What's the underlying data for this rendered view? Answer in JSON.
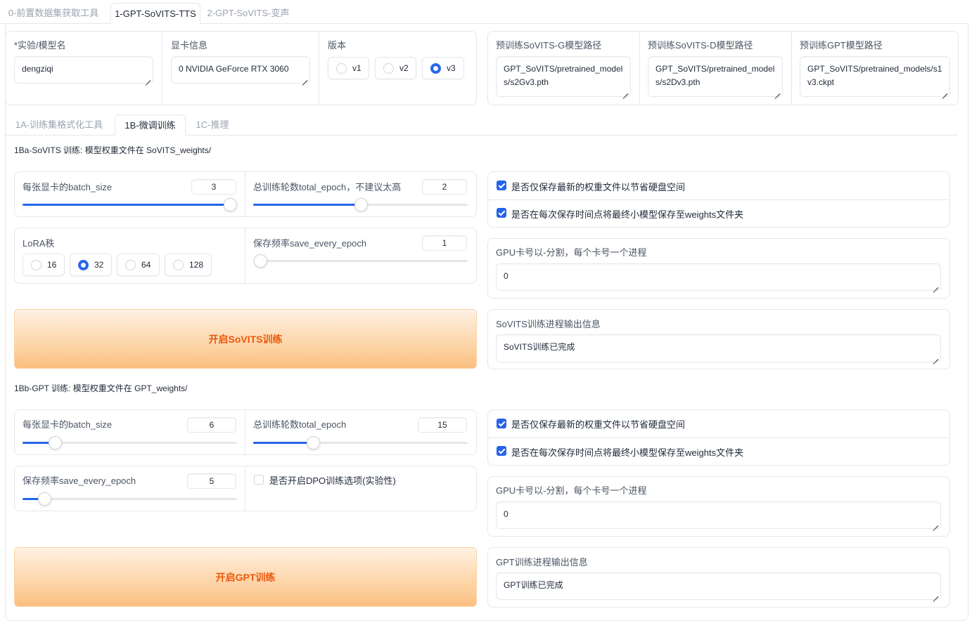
{
  "top_tabs": [
    "0-前置数据集获取工具",
    "1-GPT-SoVITS-TTS",
    "2-GPT-SoVITS-变声"
  ],
  "top_tab_active": 1,
  "config": {
    "exp_name_label": "*实验/模型名",
    "exp_name_value": "dengziqi",
    "gpu_info_label": "显卡信息",
    "gpu_info_value": "0 NVIDIA GeForce RTX 3060",
    "version_label": "版本",
    "version_options": [
      "v1",
      "v2",
      "v3"
    ],
    "version_selected": "v3"
  },
  "pretrained": {
    "sovits_g_label": "预训练SoVITS-G模型路径",
    "sovits_g_value": "GPT_SoVITS/pretrained_models/s2Gv3.pth",
    "sovits_d_label": "预训练SoVITS-D模型路径",
    "sovits_d_value": "GPT_SoVITS/pretrained_models/s2Dv3.pth",
    "gpt_label": "预训练GPT模型路径",
    "gpt_value": "GPT_SoVITS/pretrained_models/s1v3.ckpt"
  },
  "sub_tabs": [
    "1A-训练集格式化工具",
    "1B-微调训练",
    "1C-推理"
  ],
  "sub_tab_active": 1,
  "sovits": {
    "section_title": "1Ba-SoVITS 训练: 模型权重文件在 SoVITS_weights/",
    "batch_size_label": "每张显卡的batch_size",
    "batch_size_value": "3",
    "batch_size_fraction": 1.0,
    "total_epoch_label": "总训练轮数total_epoch，不建议太高",
    "total_epoch_value": "2",
    "total_epoch_fraction": 0.5,
    "lora_label": "LoRA秩",
    "lora_options": [
      "16",
      "32",
      "64",
      "128"
    ],
    "lora_selected": "32",
    "save_every_label": "保存频率save_every_epoch",
    "save_every_value": "1",
    "save_every_fraction": 0.0,
    "if_save_latest_label": "是否仅保存最新的权重文件以节省硬盘空间",
    "if_save_latest": true,
    "if_save_every_weights_label": "是否在每次保存时间点将最终小模型保存至weights文件夹",
    "if_save_every_weights": true,
    "gpu_numbers_label": "GPU卡号以-分割，每个卡号一个进程",
    "gpu_numbers_value": "0",
    "start_button": "开启SoVITS训练",
    "output_label": "SoVITS训练进程输出信息",
    "output_value": "SoVITS训练已完成"
  },
  "gpt": {
    "section_title": "1Bb-GPT 训练: 模型权重文件在 GPT_weights/",
    "batch_size_label": "每张显卡的batch_size",
    "batch_size_value": "6",
    "batch_size_fraction": 0.15,
    "total_epoch_label": "总训练轮数total_epoch",
    "total_epoch_value": "15",
    "total_epoch_fraction": 0.28,
    "save_every_label": "保存频率save_every_epoch",
    "save_every_value": "5",
    "save_every_fraction": 0.1,
    "dpo_label": "是否开启DPO训练选项(实验性)",
    "dpo_enabled": false,
    "if_save_latest_label": "是否仅保存最新的权重文件以节省硬盘空间",
    "if_save_latest": true,
    "if_save_every_weights_label": "是否在每次保存时间点将最终小模型保存至weights文件夹",
    "if_save_every_weights": true,
    "gpu_numbers_label": "GPU卡号以-分割，每个卡号一个进程",
    "gpu_numbers_value": "0",
    "start_button": "开启GPT训练",
    "output_label": "GPT训练进程输出信息",
    "output_value": "GPT训练已完成"
  },
  "colors": {
    "accent": "#2563eb",
    "button_text": "#ea580c",
    "button_bg": "#fdd5a8"
  }
}
